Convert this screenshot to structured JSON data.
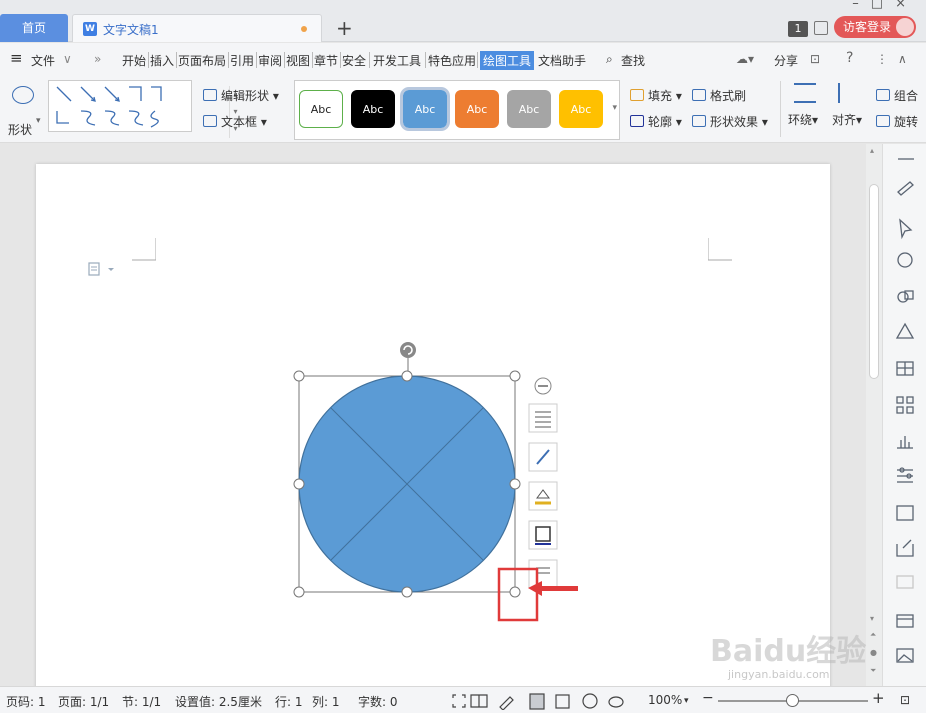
{
  "titlebar": {
    "home_tab": "首页",
    "doc_tab": "文字文稿1",
    "new_tab_symbol": "+",
    "page_badge": "1",
    "login_label": "访客登录"
  },
  "menubar": {
    "menu_label": "文件",
    "items": [
      "开始",
      "插入",
      "页面布局",
      "引用",
      "审阅",
      "视图",
      "章节",
      "安全",
      "开发工具",
      "特色应用",
      "绘图工具",
      "文档助手"
    ],
    "search_label": "查找",
    "share_label": "分享"
  },
  "ribbon": {
    "shape_label": "形状",
    "edit_shape_label": "编辑形状",
    "textbox_label": "文本框",
    "style_tiles": [
      {
        "label": "Abc",
        "bg": "#ffffff",
        "fg": "#222222",
        "border": "#5db04a"
      },
      {
        "label": "Abc",
        "bg": "#000000",
        "fg": "#ffffff",
        "border": "#000000"
      },
      {
        "label": "Abc",
        "bg": "#5b9bd5",
        "fg": "#ffffff",
        "border": "#5b9bd5"
      },
      {
        "label": "Abc",
        "bg": "#ed7d31",
        "fg": "#ffffff",
        "border": "#ed7d31"
      },
      {
        "label": "Abc",
        "bg": "#a5a5a5",
        "fg": "#ffffff",
        "border": "#a5a5a5"
      },
      {
        "label": "Abc",
        "bg": "#ffc000",
        "fg": "#ffffff",
        "border": "#ffc000"
      }
    ],
    "fill_label": "填充",
    "format_painter_label": "格式刷",
    "outline_label": "轮廓",
    "shape_effect_label": "形状效果",
    "wrap_label": "环绕",
    "align_label": "对齐",
    "group_label": "组合",
    "rotate_label": "旋转"
  },
  "document": {
    "shape_fill": "#5b9bd5",
    "shape_stroke": "#41719c",
    "highlight_color": "#e03a3a"
  },
  "statusbar": {
    "page_num": "页码: 1",
    "pages": "页面: 1/1",
    "section": "节: 1/1",
    "setting": "设置值: 2.5厘米",
    "row": "行: 1",
    "col": "列: 1",
    "words": "字数: 0",
    "zoom": "100%"
  },
  "watermark": {
    "brand": "Baidu经验",
    "url": "jingyan.baidu.com"
  },
  "colors": {
    "accent": "#4c8de0",
    "login": "#e35858",
    "home_tab": "#5b8fe0"
  }
}
